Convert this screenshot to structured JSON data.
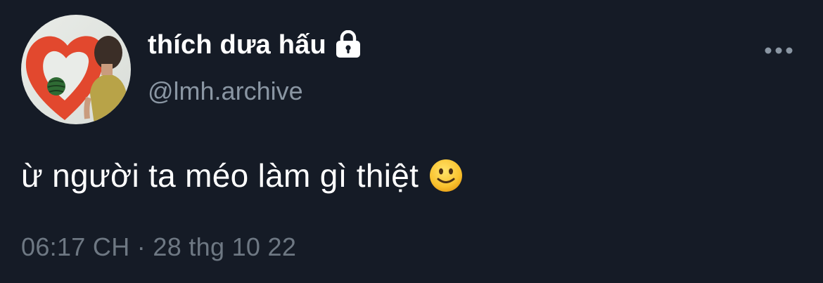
{
  "author": {
    "display_name": "thích dưa hấu",
    "handle": "@lmh.archive",
    "protected_icon": "lock-icon",
    "avatar_icon": "avatar-image"
  },
  "tweet": {
    "text": "ừ người ta méo làm gì thiệt",
    "emoji": "slightly-smiling-face-icon"
  },
  "meta": {
    "timestamp": "06:17 CH · 28 thg 10 22"
  },
  "menu": {
    "icon": "more-options-icon"
  },
  "colors": {
    "background": "#151b26",
    "primary_text": "#ffffff",
    "secondary_text": "#8a96a3",
    "timestamp_text": "#6e7883"
  }
}
